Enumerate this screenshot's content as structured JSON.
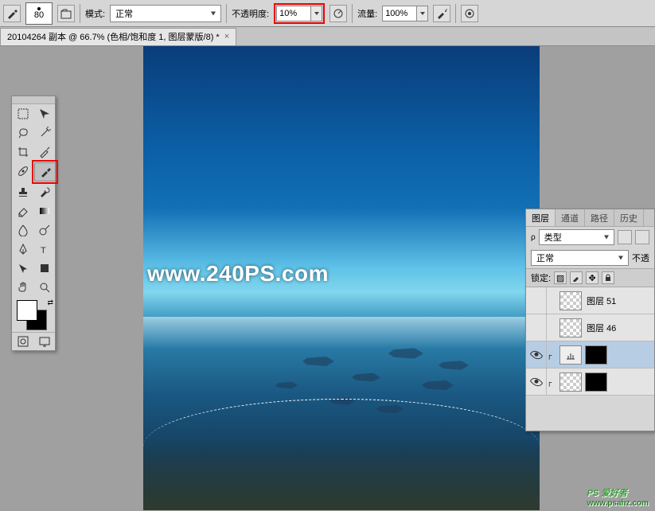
{
  "options_bar": {
    "brush_size": "80",
    "mode_label": "模式:",
    "mode_value": "正常",
    "opacity_label": "不透明度:",
    "opacity_value": "10%",
    "flow_label": "流量:",
    "flow_value": "100%"
  },
  "doc_tab": {
    "title": "20104264 副本 @ 66.7% (色相/饱和度 1, 图层蒙版/8) *"
  },
  "watermark": "www.240PS.com",
  "bottom_watermark": {
    "text": "PS 爱好者",
    "url": "www.psahz.com"
  },
  "toolbox": {
    "tools": [
      {
        "name": "marquee-tool",
        "icon": "rect-dashed"
      },
      {
        "name": "move-tool",
        "icon": "move"
      },
      {
        "name": "lasso-tool",
        "icon": "lasso"
      },
      {
        "name": "magic-wand-tool",
        "icon": "wand"
      },
      {
        "name": "crop-tool",
        "icon": "crop"
      },
      {
        "name": "eyedropper-tool",
        "icon": "eyedropper"
      },
      {
        "name": "spot-heal-tool",
        "icon": "bandage"
      },
      {
        "name": "brush-tool",
        "icon": "brush",
        "active": true,
        "highlighted": true
      },
      {
        "name": "clone-stamp-tool",
        "icon": "stamp"
      },
      {
        "name": "history-brush-tool",
        "icon": "history-brush"
      },
      {
        "name": "eraser-tool",
        "icon": "eraser"
      },
      {
        "name": "gradient-tool",
        "icon": "gradient"
      },
      {
        "name": "blur-tool",
        "icon": "blur"
      },
      {
        "name": "dodge-tool",
        "icon": "dodge"
      },
      {
        "name": "pen-tool",
        "icon": "pen"
      },
      {
        "name": "type-tool",
        "icon": "type"
      },
      {
        "name": "path-select-tool",
        "icon": "path-select"
      },
      {
        "name": "shape-tool",
        "icon": "shape"
      },
      {
        "name": "hand-tool",
        "icon": "hand"
      },
      {
        "name": "zoom-tool",
        "icon": "zoom"
      }
    ]
  },
  "layers_panel": {
    "tabs": [
      "图层",
      "通道",
      "路径",
      "历史"
    ],
    "active_tab": 0,
    "kind_label": "类型",
    "blend_mode": "正常",
    "opacity_label": "不透",
    "lock_label": "锁定:",
    "layers": [
      {
        "visible": false,
        "name": "图层 51",
        "thumbs": [
          "checker"
        ]
      },
      {
        "visible": false,
        "name": "图层 46",
        "thumbs": [
          "checker"
        ]
      },
      {
        "visible": true,
        "name": "",
        "thumbs": [
          "adj",
          "mask"
        ],
        "selected": true,
        "clipped": true
      },
      {
        "visible": true,
        "name": "",
        "thumbs": [
          "checker",
          "mask"
        ],
        "clipped": true
      }
    ]
  }
}
